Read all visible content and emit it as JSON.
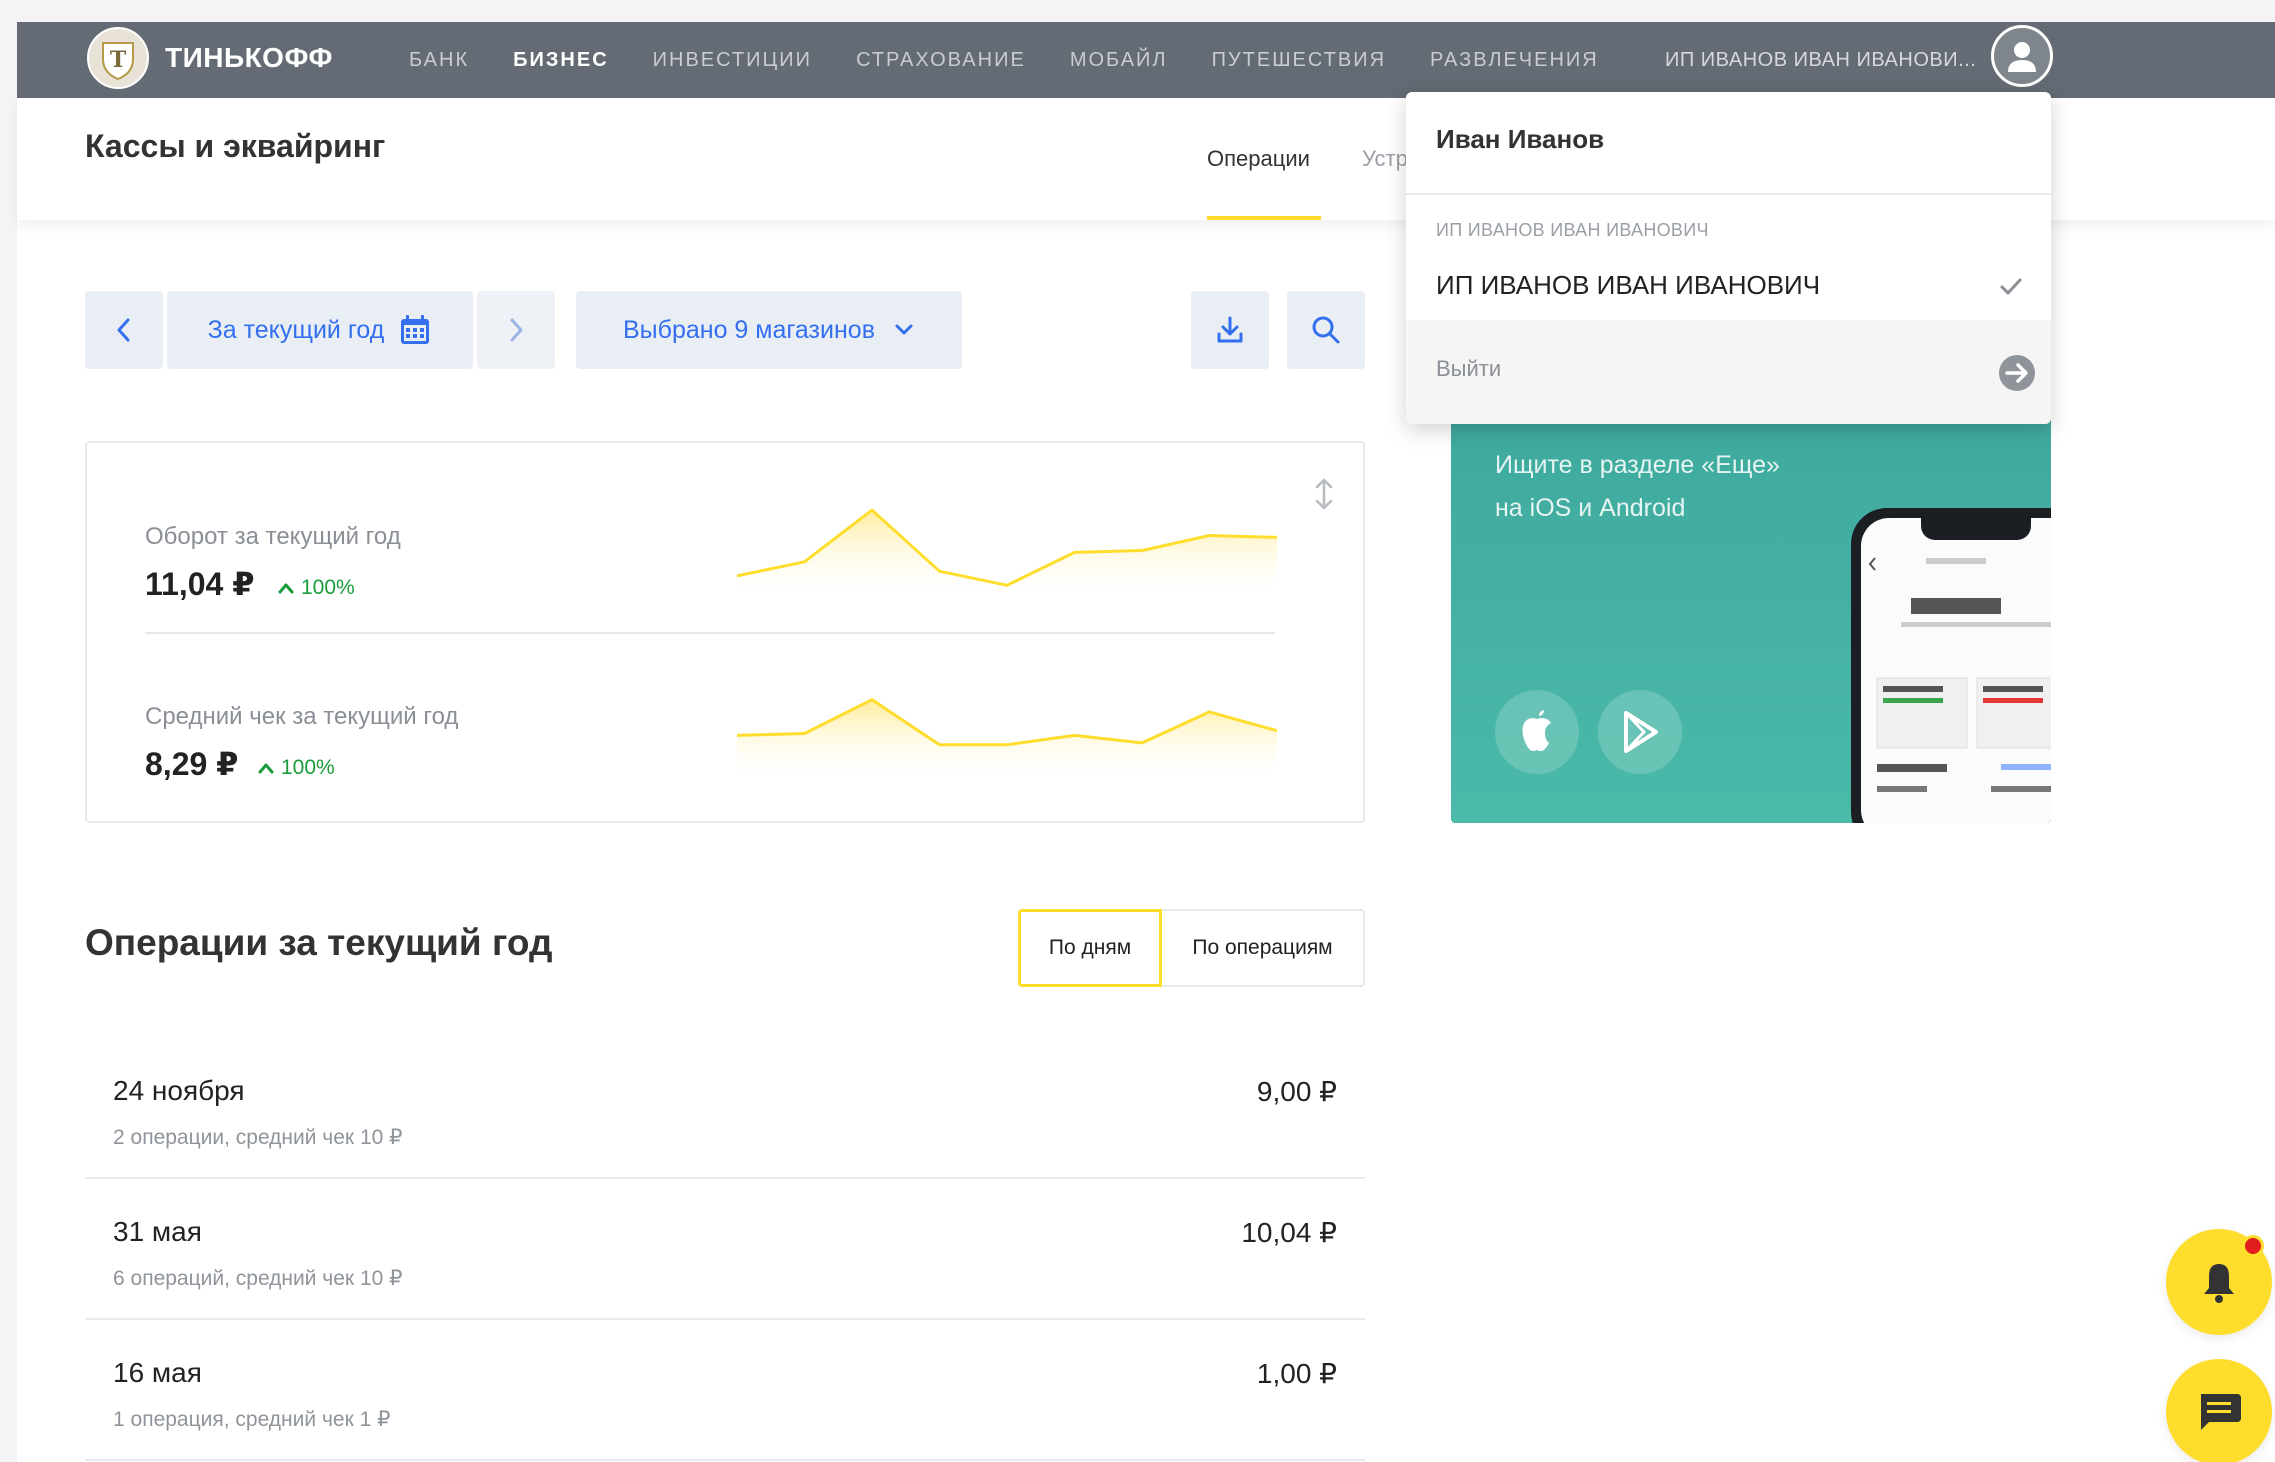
{
  "header": {
    "logo_text": "ТИНЬКОФФ",
    "nav": [
      "БАНК",
      "БИЗНЕС",
      "ИНВЕСТИЦИИ",
      "СТРАХОВАНИЕ",
      "МОБАЙЛ",
      "ПУТЕШЕСТВИЯ",
      "РАЗВЛЕЧЕНИЯ"
    ],
    "active_nav": "БИЗНЕС",
    "user_label": "ИП ИВАНОВ ИВАН ИВАНОВИ..."
  },
  "subheader": {
    "title": "Кассы и эквайринг",
    "tabs": [
      "Операции",
      "Устр"
    ]
  },
  "controls": {
    "period_label": "За текущий год",
    "stores_label": "Выбрано 9 магазинов"
  },
  "stats": {
    "turnover": {
      "label": "Оборот за текущий год",
      "value": "11,04 ₽",
      "change": "100%"
    },
    "avg_check": {
      "label": "Средний чек за текущий год",
      "value": "8,29 ₽",
      "change": "100%"
    }
  },
  "sparklines": {
    "turnover": [
      0.15,
      0.3,
      0.85,
      0.2,
      0.05,
      0.4,
      0.42,
      0.58,
      0.56
    ],
    "avg_check": [
      0.4,
      0.42,
      0.78,
      0.3,
      0.3,
      0.4,
      0.32,
      0.65,
      0.45
    ]
  },
  "promo": {
    "text_line1": "Ищите в разделе «Еще»",
    "text_line2": "на iOS и Android"
  },
  "dropdown": {
    "name": "Иван Иванов",
    "section_label": "ИП ИВАНОВ ИВАН ИВАНОВИЧ",
    "company": "ИП ИВАНОВ ИВАН ИВАНОВИЧ",
    "logout": "Выйти"
  },
  "operations": {
    "title": "Операции за текущий год",
    "toggle": [
      "По дням",
      "По операциям"
    ],
    "rows": [
      {
        "date": "24 ноября",
        "sub": "2 операции, средний чек 10 ₽",
        "amount": "9,00 ₽"
      },
      {
        "date": "31 мая",
        "sub": "6 операций, средний чек 10 ₽",
        "amount": "10,04 ₽"
      },
      {
        "date": "16 мая",
        "sub": "1 операция, средний чек 1 ₽",
        "amount": "1,00 ₽"
      }
    ]
  },
  "colors": {
    "topbar": "#646b74",
    "accent_yellow": "#ffdd2d",
    "link_blue": "#336fee",
    "positive_green": "#1a9c3a",
    "promo_teal": "#45b2a4"
  },
  "icons": [
    "calendar-icon",
    "chevron-left-icon",
    "chevron-right-icon",
    "chevron-down-icon",
    "download-icon",
    "search-icon",
    "expand-icon",
    "check-icon",
    "logout-arrow-icon",
    "apple-icon",
    "google-play-icon",
    "bell-icon",
    "chat-icon",
    "user-avatar-icon"
  ]
}
